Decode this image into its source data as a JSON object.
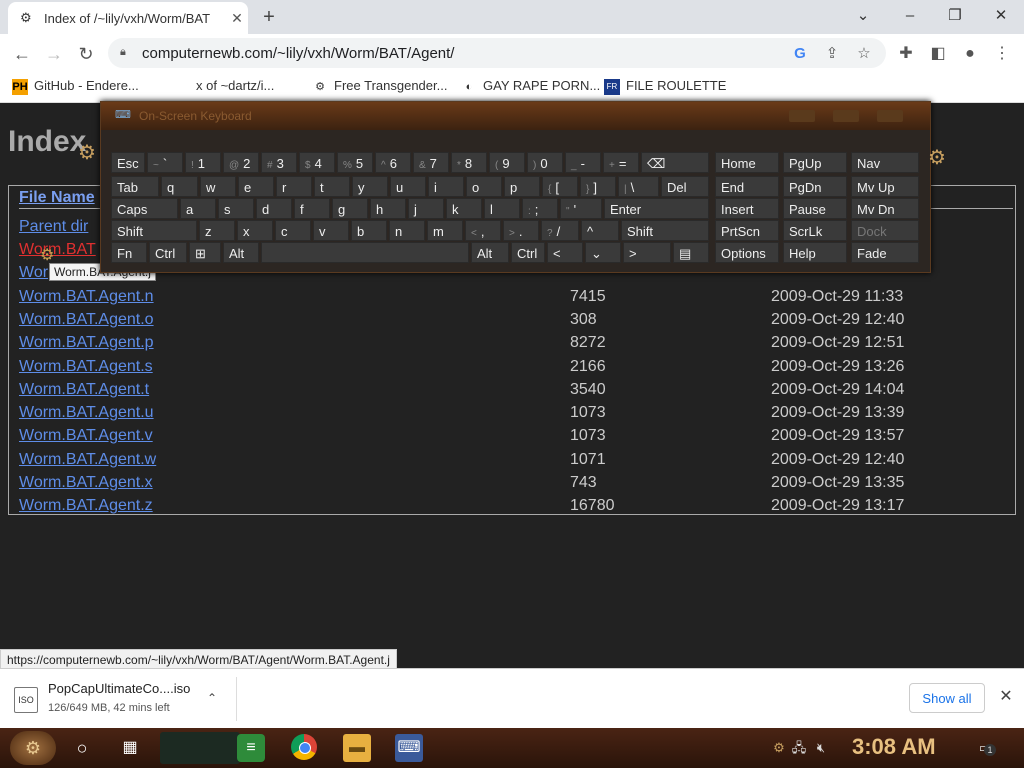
{
  "browser": {
    "tab_title": "Index of /~lily/vxh/Worm/BAT",
    "tab_favicon": "gear-icon",
    "url": "computernewb.com/~lily/vxh/Worm/BAT/Agent/",
    "window_controls": {
      "minimize": "–",
      "restore": "❐",
      "close": "✕",
      "dropdown": "⌄"
    }
  },
  "bookmarks": [
    {
      "label": "GitHub - Endere...",
      "icon": "PH"
    },
    {
      "label": "x of ~dartz/i...",
      "icon": "⚙"
    },
    {
      "label": "Free Transgender...",
      "icon": "⚙"
    },
    {
      "label": "GAY RAPE PORN...",
      "icon": "◐"
    },
    {
      "label": "FILE ROULETTE",
      "icon": "FR"
    }
  ],
  "page": {
    "heading": "Index",
    "column_name": "File Name",
    "rows": [
      {
        "name": "Parent dir",
        "size": "",
        "date": "",
        "hovered": false
      },
      {
        "name": "Worm.BAT",
        "size": "",
        "date": "",
        "hovered": true
      },
      {
        "name": "Wor",
        "size": "",
        "date": "",
        "hovered": false
      },
      {
        "name": "Worm.BAT.Agent.n",
        "size": "7415",
        "date": "2009-Oct-29 11:33",
        "hovered": false
      },
      {
        "name": "Worm.BAT.Agent.o",
        "size": "308",
        "date": "2009-Oct-29 12:40",
        "hovered": false
      },
      {
        "name": "Worm.BAT.Agent.p",
        "size": "8272",
        "date": "2009-Oct-29 12:51",
        "hovered": false
      },
      {
        "name": "Worm.BAT.Agent.s",
        "size": "2166",
        "date": "2009-Oct-29 13:26",
        "hovered": false
      },
      {
        "name": "Worm.BAT.Agent.t",
        "size": "3540",
        "date": "2009-Oct-29 14:04",
        "hovered": false
      },
      {
        "name": "Worm.BAT.Agent.u",
        "size": "1073",
        "date": "2009-Oct-29 13:39",
        "hovered": false
      },
      {
        "name": "Worm.BAT.Agent.v",
        "size": "1073",
        "date": "2009-Oct-29 13:57",
        "hovered": false
      },
      {
        "name": "Worm.BAT.Agent.w",
        "size": "1071",
        "date": "2009-Oct-29 12:40",
        "hovered": false
      },
      {
        "name": "Worm.BAT.Agent.x",
        "size": "743",
        "date": "2009-Oct-29 13:35",
        "hovered": false
      },
      {
        "name": "Worm.BAT.Agent.z",
        "size": "16780",
        "date": "2009-Oct-29 13:17",
        "hovered": false
      }
    ],
    "tooltip": "Worm.BAT.Agent.j",
    "status_url": "https://computernewb.com/~lily/vxh/Worm/BAT/Agent/Worm.BAT.Agent.j"
  },
  "osk": {
    "title": "On-Screen Keyboard",
    "rows": [
      [
        {
          "l": "Esc"
        },
        {
          "s": "~",
          "l": "`"
        },
        {
          "s": "!",
          "l": "1"
        },
        {
          "s": "@",
          "l": "2"
        },
        {
          "s": "#",
          "l": "3"
        },
        {
          "s": "$",
          "l": "4"
        },
        {
          "s": "%",
          "l": "5"
        },
        {
          "s": "^",
          "l": "6"
        },
        {
          "s": "&",
          "l": "7"
        },
        {
          "s": "*",
          "l": "8"
        },
        {
          "s": "(",
          "l": "9"
        },
        {
          "s": ")",
          "l": "0"
        },
        {
          "s": "_",
          "l": "-"
        },
        {
          "s": "+",
          "l": "="
        },
        {
          "l": "⌫"
        }
      ],
      [
        {
          "l": "Tab"
        },
        {
          "l": "q"
        },
        {
          "l": "w"
        },
        {
          "l": "e"
        },
        {
          "l": "r"
        },
        {
          "l": "t"
        },
        {
          "l": "y"
        },
        {
          "l": "u"
        },
        {
          "l": "i"
        },
        {
          "l": "o"
        },
        {
          "l": "p"
        },
        {
          "s": "{",
          "l": "["
        },
        {
          "s": "}",
          "l": "]"
        },
        {
          "s": "|",
          "l": "\\"
        },
        {
          "l": "Del"
        }
      ],
      [
        {
          "l": "Caps"
        },
        {
          "l": "a"
        },
        {
          "l": "s"
        },
        {
          "l": "d"
        },
        {
          "l": "f"
        },
        {
          "l": "g"
        },
        {
          "l": "h"
        },
        {
          "l": "j"
        },
        {
          "l": "k"
        },
        {
          "l": "l"
        },
        {
          "s": ":",
          "l": ";"
        },
        {
          "s": "\"",
          "l": "'"
        },
        {
          "l": "Enter"
        }
      ],
      [
        {
          "l": "Shift"
        },
        {
          "l": "z"
        },
        {
          "l": "x"
        },
        {
          "l": "c"
        },
        {
          "l": "v"
        },
        {
          "l": "b"
        },
        {
          "l": "n"
        },
        {
          "l": "m"
        },
        {
          "s": "<",
          "l": ","
        },
        {
          "s": ">",
          "l": "."
        },
        {
          "s": "?",
          "l": "/"
        },
        {
          "l": "^"
        },
        {
          "l": "Shift"
        }
      ],
      [
        {
          "l": "Fn"
        },
        {
          "l": "Ctrl"
        },
        {
          "l": "⊞"
        },
        {
          "l": "Alt"
        },
        {
          "l": ""
        },
        {
          "l": "Alt"
        },
        {
          "l": "Ctrl"
        },
        {
          "l": "<"
        },
        {
          "l": "⌄"
        },
        {
          "l": ">"
        },
        {
          "l": "▤"
        }
      ]
    ],
    "nav_keys": [
      [
        "Home",
        "PgUp",
        "Nav"
      ],
      [
        "End",
        "PgDn",
        "Mv Up"
      ],
      [
        "Insert",
        "Pause",
        "Mv Dn"
      ],
      [
        "PrtScn",
        "ScrLk",
        "Dock"
      ],
      [
        "Options",
        "Help",
        "Fade"
      ]
    ]
  },
  "download": {
    "filename": "PopCapUltimateCo....iso",
    "progress_text": "126/649 MB, 42 mins left",
    "file_icon": "ISO",
    "show_all": "Show all"
  },
  "taskbar": {
    "time": "3:08 AM",
    "notification_count": "1"
  }
}
